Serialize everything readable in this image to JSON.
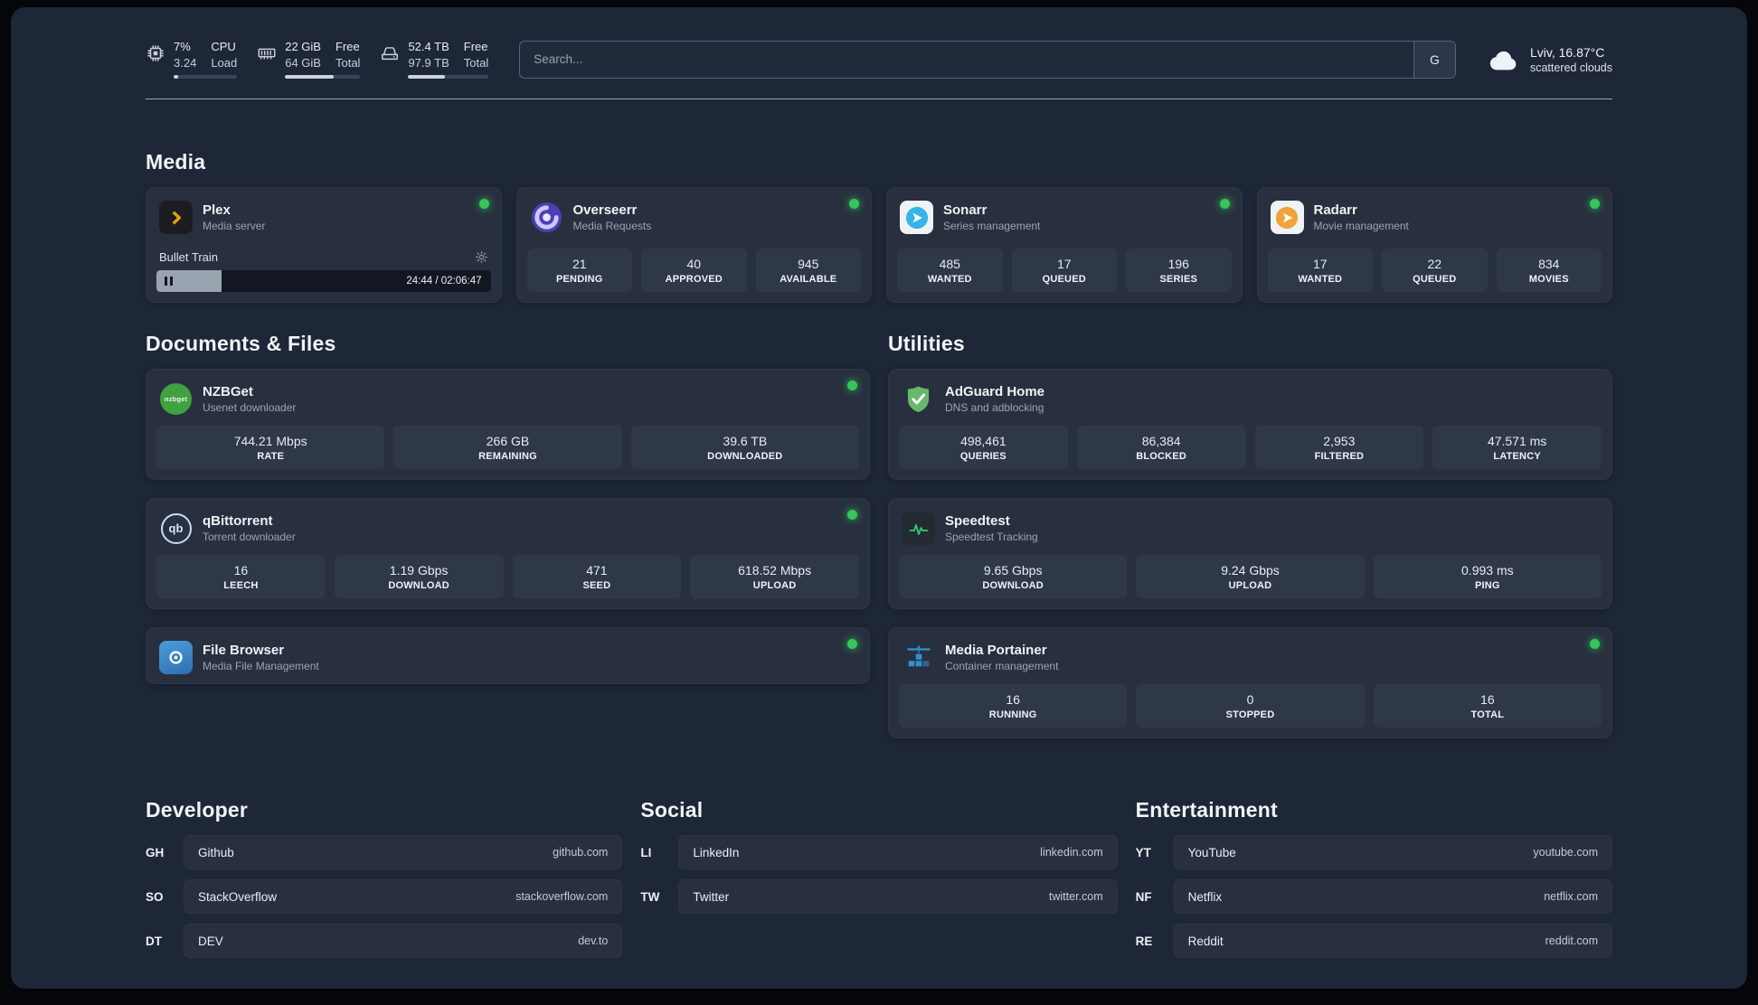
{
  "topbar": {
    "cpu": {
      "col1_top": "7%",
      "col1_bottom": "3.24",
      "col2_top": "CPU",
      "col2_bottom": "Load",
      "bar_percent": 7
    },
    "ram": {
      "col1_top": "22 GiB",
      "col1_bottom": "64 GiB",
      "col2_top": "Free",
      "col2_bottom": "Total",
      "bar_percent": 65
    },
    "disk": {
      "col1_top": "52.4 TB",
      "col1_bottom": "97.9 TB",
      "col2_top": "Free",
      "col2_bottom": "Total",
      "bar_percent": 46
    },
    "search": {
      "placeholder": "Search...",
      "provider_label": "G"
    },
    "weather": {
      "location": "Lviv, 16.87°C",
      "condition": "scattered clouds"
    }
  },
  "sections": {
    "media": {
      "title": "Media",
      "apps": [
        {
          "name": "Plex",
          "subtitle": "Media server",
          "icon": "plex-icon",
          "online": true,
          "now_playing": {
            "title": "Bullet Train",
            "time": "24:44 / 02:06:47",
            "progress_percent": 19.5
          }
        },
        {
          "name": "Overseerr",
          "subtitle": "Media Requests",
          "icon": "overseerr-icon",
          "online": true,
          "stats": [
            {
              "value": "21",
              "label": "PENDING"
            },
            {
              "value": "40",
              "label": "APPROVED"
            },
            {
              "value": "945",
              "label": "AVAILABLE"
            }
          ]
        },
        {
          "name": "Sonarr",
          "subtitle": "Series management",
          "icon": "sonarr-icon",
          "online": true,
          "stats": [
            {
              "value": "485",
              "label": "WANTED"
            },
            {
              "value": "17",
              "label": "QUEUED"
            },
            {
              "value": "196",
              "label": "SERIES"
            }
          ]
        },
        {
          "name": "Radarr",
          "subtitle": "Movie management",
          "icon": "radarr-icon",
          "online": true,
          "stats": [
            {
              "value": "17",
              "label": "WANTED"
            },
            {
              "value": "22",
              "label": "QUEUED"
            },
            {
              "value": "834",
              "label": "MOVIES"
            }
          ]
        }
      ]
    },
    "documents": {
      "title": "Documents & Files",
      "apps": [
        {
          "name": "NZBGet",
          "subtitle": "Usenet downloader",
          "icon": "nzbget-icon",
          "icon_text": "nzbget",
          "online": true,
          "stats": [
            {
              "value": "744.21 Mbps",
              "label": "RATE"
            },
            {
              "value": "266 GB",
              "label": "REMAINING"
            },
            {
              "value": "39.6 TB",
              "label": "DOWNLOADED"
            }
          ]
        },
        {
          "name": "qBittorrent",
          "subtitle": "Torrent downloader",
          "icon": "qbittorrent-icon",
          "icon_text": "qb",
          "online": true,
          "stats": [
            {
              "value": "16",
              "label": "LEECH"
            },
            {
              "value": "1.19 Gbps",
              "label": "DOWNLOAD"
            },
            {
              "value": "471",
              "label": "SEED"
            },
            {
              "value": "618.52 Mbps",
              "label": "UPLOAD"
            }
          ]
        },
        {
          "name": "File Browser",
          "subtitle": "Media File Management",
          "icon": "filebrowser-icon",
          "online": true
        }
      ]
    },
    "utilities": {
      "title": "Utilities",
      "apps": [
        {
          "name": "AdGuard Home",
          "subtitle": "DNS and adblocking",
          "icon": "adguard-icon",
          "stats": [
            {
              "value": "498,461",
              "label": "QUERIES"
            },
            {
              "value": "86,384",
              "label": "BLOCKED"
            },
            {
              "value": "2,953",
              "label": "FILTERED"
            },
            {
              "value": "47.571 ms",
              "label": "LATENCY"
            }
          ]
        },
        {
          "name": "Speedtest",
          "subtitle": "Speedtest Tracking",
          "icon": "speedtest-icon",
          "stats": [
            {
              "value": "9.65 Gbps",
              "label": "DOWNLOAD"
            },
            {
              "value": "9.24 Gbps",
              "label": "UPLOAD"
            },
            {
              "value": "0.993 ms",
              "label": "PING"
            }
          ]
        },
        {
          "name": "Media Portainer",
          "subtitle": "Container management",
          "icon": "portainer-icon",
          "online": true,
          "stats": [
            {
              "value": "16",
              "label": "RUNNING"
            },
            {
              "value": "0",
              "label": "STOPPED"
            },
            {
              "value": "16",
              "label": "TOTAL"
            }
          ]
        }
      ]
    },
    "developer": {
      "title": "Developer",
      "links": [
        {
          "code": "GH",
          "name": "Github",
          "url": "github.com"
        },
        {
          "code": "SO",
          "name": "StackOverflow",
          "url": "stackoverflow.com"
        },
        {
          "code": "DT",
          "name": "DEV",
          "url": "dev.to"
        }
      ]
    },
    "social": {
      "title": "Social",
      "links": [
        {
          "code": "LI",
          "name": "LinkedIn",
          "url": "linkedin.com"
        },
        {
          "code": "TW",
          "name": "Twitter",
          "url": "twitter.com"
        }
      ]
    },
    "entertainment": {
      "title": "Entertainment",
      "links": [
        {
          "code": "YT",
          "name": "YouTube",
          "url": "youtube.com"
        },
        {
          "code": "NF",
          "name": "Netflix",
          "url": "netflix.com"
        },
        {
          "code": "RE",
          "name": "Reddit",
          "url": "reddit.com"
        }
      ]
    }
  },
  "colors": {
    "status_online": "#35c65a",
    "plex_gold": "#e5a00d",
    "sonarr_blue": "#35b4e8",
    "radarr_amber": "#f1a33b",
    "overseerr_purple": "#4c3fb5",
    "adguard_green": "#67b868",
    "speedtest_green": "#2ecc71",
    "portainer_blue": "#3090d0",
    "nzbget_green": "#3fa23f",
    "filebrowser_blue": "#3d87c3"
  },
  "icons": {
    "cpu": "cpu-chip-icon",
    "ram": "memory-icon",
    "disk": "hard-drive-icon",
    "weather": "cloud-icon",
    "plex_settings": "gear-icon",
    "player_pause": "pause-icon",
    "status": "status-dot"
  }
}
